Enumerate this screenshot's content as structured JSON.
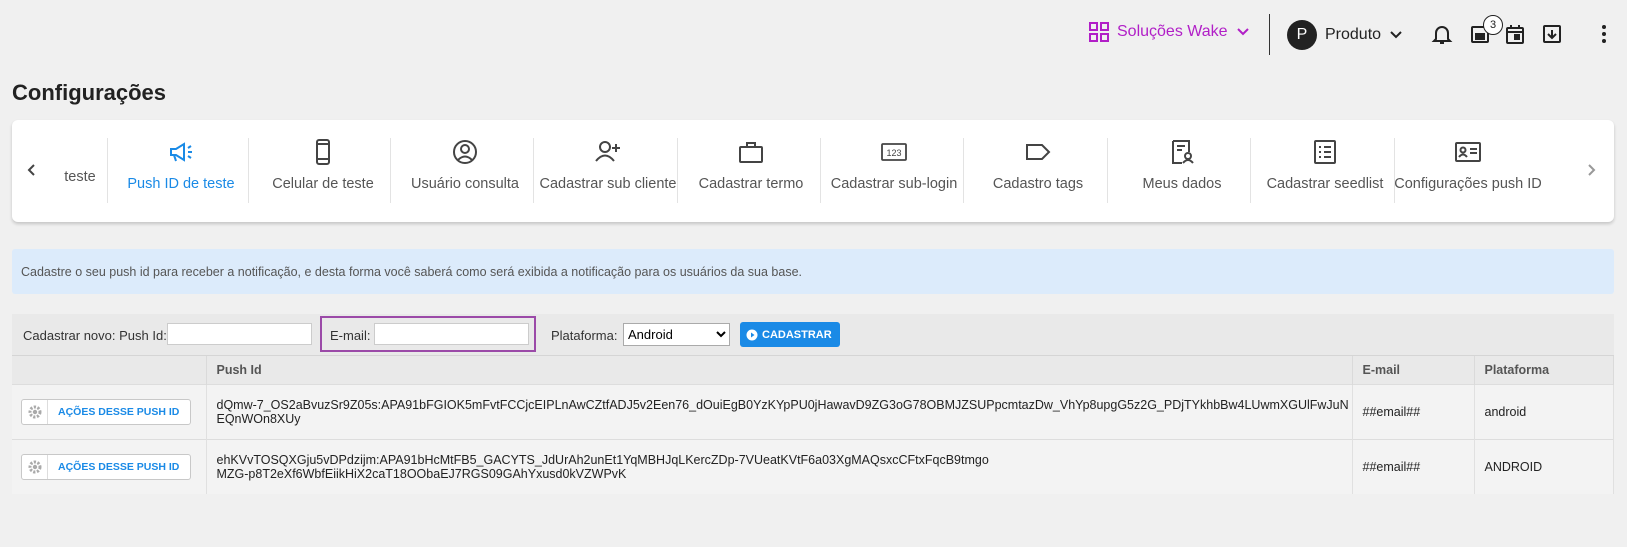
{
  "header": {
    "solucoes_label": "Soluções Wake",
    "avatar_initial": "P",
    "produto_label": "Produto",
    "notification_count": "3"
  },
  "page": {
    "title": "Configurações"
  },
  "menu": {
    "items": [
      {
        "label": "teste",
        "icon": "partial-item"
      },
      {
        "label": "Push ID de teste",
        "icon": "megaphone-icon",
        "active": true
      },
      {
        "label": "Celular de teste",
        "icon": "phone-icon"
      },
      {
        "label": "Usuário consulta",
        "icon": "user-circle-icon"
      },
      {
        "label": "Cadastrar sub cliente",
        "icon": "add-user-icon"
      },
      {
        "label": "Cadastrar termo",
        "icon": "briefcase-icon"
      },
      {
        "label": "Cadastrar sub-login",
        "icon": "numeric-123-icon"
      },
      {
        "label": "Cadastro tags",
        "icon": "tag-icon"
      },
      {
        "label": "Meus dados",
        "icon": "profile-doc-icon"
      },
      {
        "label": "Cadastrar seedlist",
        "icon": "checklist-icon"
      },
      {
        "label": "Configurações push ID",
        "icon": "id-card-icon"
      }
    ]
  },
  "info": {
    "text": "Cadastre o seu push id para receber a notificação, e desta forma você saberá como será exibida a notificação para os usuários da sua base."
  },
  "form": {
    "push_id_label": "Cadastrar novo: Push Id:",
    "email_label": "E-mail:",
    "plataforma_label": "Plataforma:",
    "plataforma_value": "Android",
    "submit_label": "CADASTRAR"
  },
  "table": {
    "headers": [
      "",
      "Push Id",
      "E-mail",
      "Plataforma"
    ],
    "action_label": "AÇÕES DESSE PUSH ID",
    "rows": [
      {
        "push_id": "dQmw-7_OS2aBvuzSr9Z05s:APA91bFGIOK5mFvtFCCjcEIPLnAwCZtfADJ5v2Een76_dOuiEgB0YzKYpPU0jHawavD9ZG3oG78OBMJZSUPpcmtazDw_VhYp8upgG5z2G_PDjTYkhbBw4LUwmXGUlFwJuNEQnWOn8XUy",
        "email": "##email##",
        "plataforma": "android"
      },
      {
        "push_id": "ehKVvTOSQXGju5vDPdzijm:APA91bHcMtFB5_GACYTS_JdUrAh2unEt1YqMBHJqLKercZDp-7VUeatKVtF6a03XgMAQsxcCFtxFqcB9tmgoMZG-p8T2eXf6WbfEiikHiX2caT18OObaEJ7RGS09GAhYxusd0kVZWPvK",
        "email": "##email##",
        "plataforma": "ANDROID"
      }
    ]
  },
  "colors": {
    "brand_purple": "#b11fc7",
    "accent_blue": "#1a8ae6",
    "info_bg": "#dcebfb",
    "highlight_border": "#9b4aa8"
  }
}
